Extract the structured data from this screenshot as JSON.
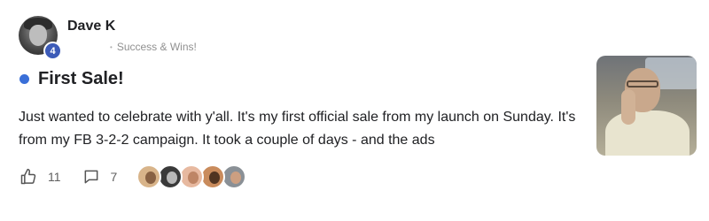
{
  "post": {
    "author": {
      "name": "Dave K",
      "level": "4",
      "avatar_icon": "user-photo-icon"
    },
    "category": "Success & Wins!",
    "title": "First Sale!",
    "body": "Just wanted to celebrate with y'all. It's my first official sale from my launch on Sunday. It's from my FB 3-2-2 campaign. It took a couple of days - and the ads",
    "thumbnail_icon": "post-thumbnail-photo"
  },
  "footer": {
    "likes": "11",
    "comments": "7",
    "like_icon": "thumbs-up-icon",
    "comment_icon": "comment-bubble-icon",
    "reactor_avatars": [
      {
        "bg": "#d8b48a",
        "face": "#7a5236"
      },
      {
        "bg": "#3a3a3a",
        "face": "#cfcfcf"
      },
      {
        "bg": "#e7b9a0",
        "face": "#b67b5b"
      },
      {
        "bg": "#c98b5c",
        "face": "#3b2416"
      },
      {
        "bg": "#8a9096",
        "face": "#d7a27e"
      }
    ]
  },
  "colors": {
    "accent": "#3a6fd8",
    "badge": "#3c5bb8",
    "muted": "#909090"
  }
}
